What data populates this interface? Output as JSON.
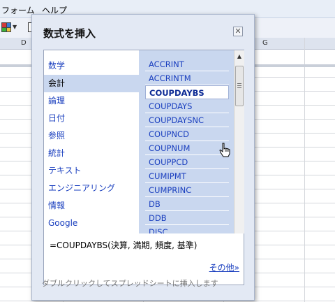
{
  "menubar": {
    "items": [
      {
        "label": "フォーム"
      },
      {
        "label": "ヘルプ"
      }
    ]
  },
  "columns": {
    "left": "D",
    "right": "G"
  },
  "dialog": {
    "title": "数式を挿入",
    "close_label": "✕",
    "categories": [
      {
        "label": "数学"
      },
      {
        "label": "会計"
      },
      {
        "label": "論理"
      },
      {
        "label": "日付"
      },
      {
        "label": "参照"
      },
      {
        "label": "統計"
      },
      {
        "label": "テキスト"
      },
      {
        "label": "エンジニアリング"
      },
      {
        "label": "情報"
      },
      {
        "label": "Google"
      }
    ],
    "selected_category": "会計",
    "functions": [
      {
        "label": "ACCRINT"
      },
      {
        "label": "ACCRINTM"
      },
      {
        "label": "COUPDAYBS"
      },
      {
        "label": "COUPDAYS"
      },
      {
        "label": "COUPDAYSNC"
      },
      {
        "label": "COUPNCD"
      },
      {
        "label": "COUPNUM"
      },
      {
        "label": "COUPPCD"
      },
      {
        "label": "CUMIPMT"
      },
      {
        "label": "CUMPRINC"
      },
      {
        "label": "DB"
      },
      {
        "label": "DDB"
      },
      {
        "label": "DISC"
      }
    ],
    "selected_function": "COUPDAYBS",
    "formula": "=COUPDAYBS(決算, 満期, 頻度, 基準)",
    "more_link": "その他»",
    "hint": "ダブルクリックしてスプレッドシートに挿入します"
  },
  "colors": {
    "link": "#1a3fbf",
    "selected_bg": "#c9d7ef",
    "dialog_bg": "#e3e9f4"
  }
}
